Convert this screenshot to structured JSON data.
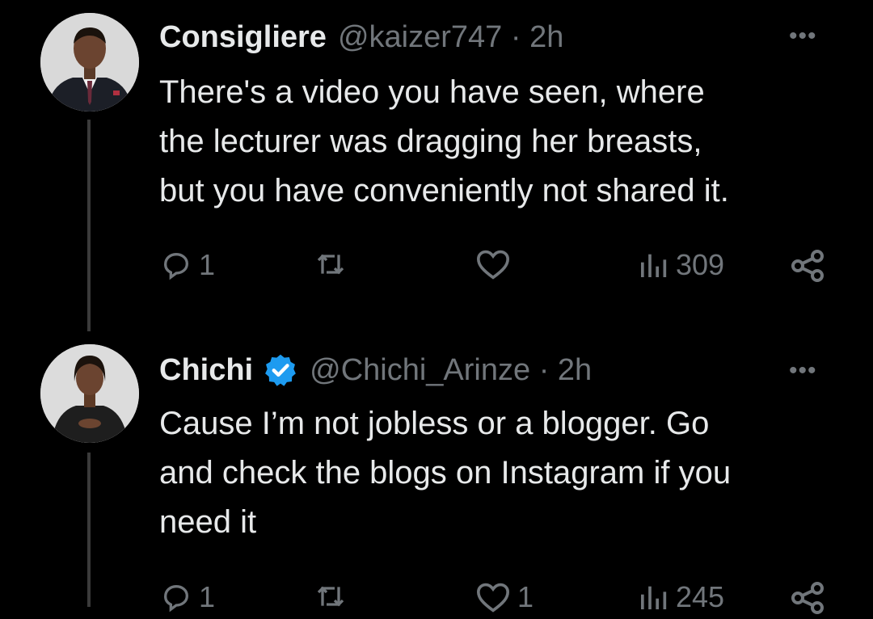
{
  "tweets": [
    {
      "name": "Consigliere",
      "handle": "@kaizer747 · 2h",
      "verified": false,
      "text_lines": [
        "There's a video you have seen, where",
        "the lecturer was dragging her breasts,",
        "but you have conveniently not shared it."
      ],
      "replies": "1",
      "retweets": "",
      "likes": "",
      "views": "309"
    },
    {
      "name": "Chichi",
      "handle": "@Chichi_Arinze · 2h",
      "verified": true,
      "text_lines": [
        "Cause I’m not jobless or a blogger. Go",
        "and check the blogs on Instagram if you",
        "need it"
      ],
      "replies": "1",
      "retweets": "",
      "likes": "1",
      "views": "245"
    }
  ],
  "more_icon_text": "•••",
  "colors": {
    "background": "#000000",
    "text": "#e7e9ea",
    "muted": "#71767b",
    "verified": "#1d9bf0",
    "thread_line": "#3b3b3b"
  }
}
